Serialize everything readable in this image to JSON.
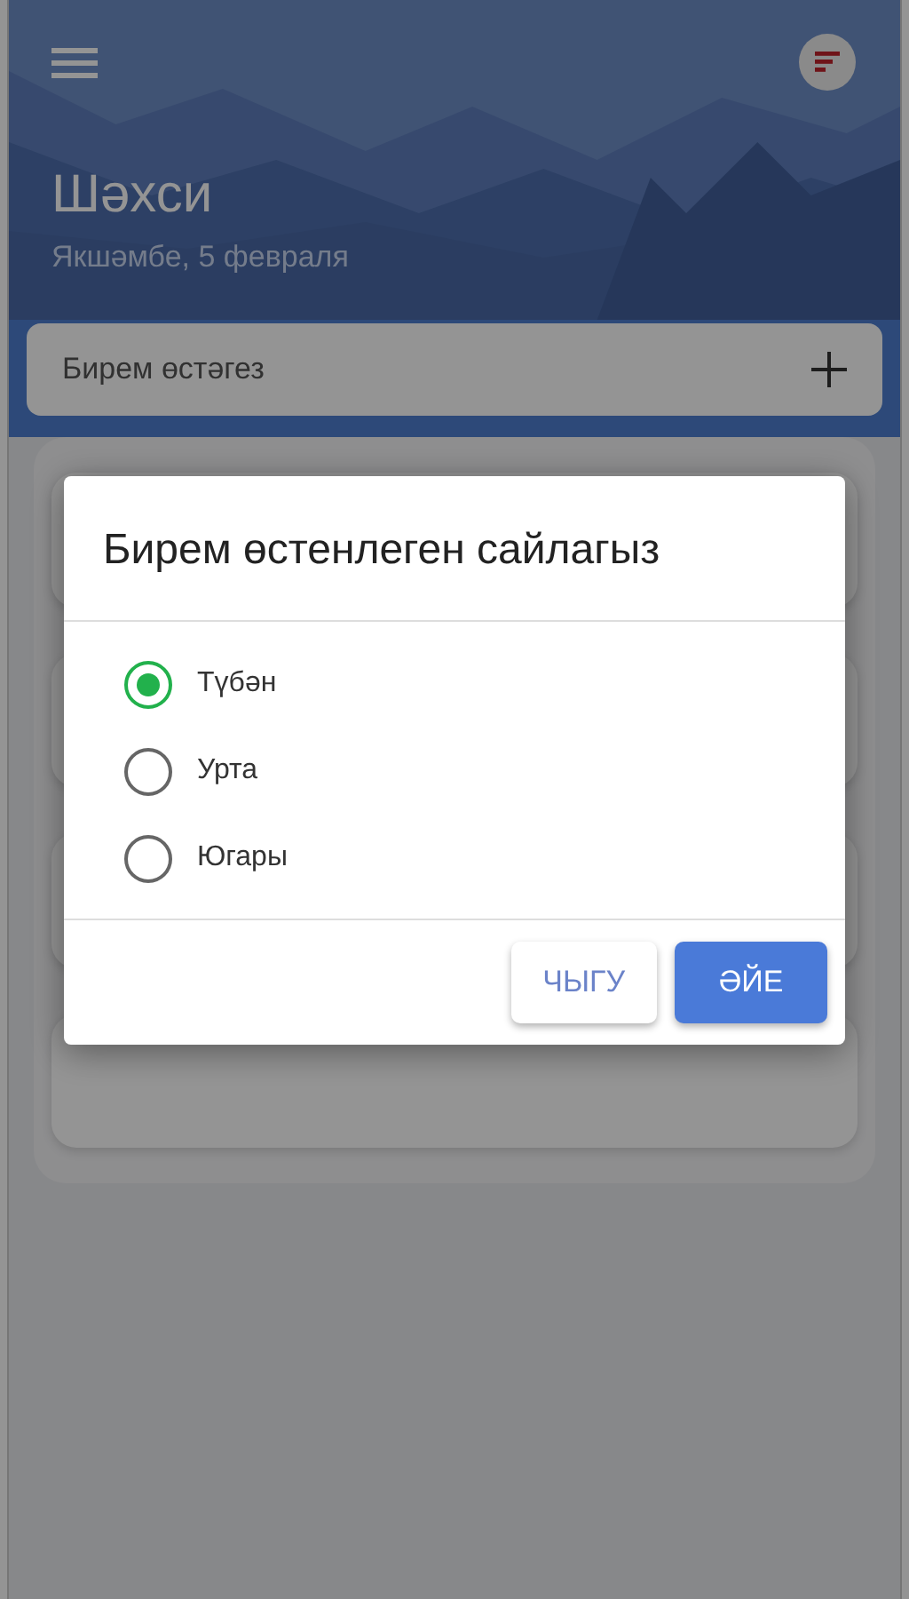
{
  "header": {
    "title": "Шәхси",
    "date": "Якшәмбе, 5 февраля"
  },
  "add_task": {
    "placeholder": "Бирем өстәгез"
  },
  "dialog": {
    "title": "Бирем өстенлеген сайлагыз",
    "options": [
      {
        "label": "Түбән",
        "selected": true
      },
      {
        "label": "Урта",
        "selected": false
      },
      {
        "label": "Югары",
        "selected": false
      }
    ],
    "buttons": [
      {
        "label": "ЧЫГУ",
        "kind": "secondary"
      },
      {
        "label": "ӘЙЕ",
        "kind": "primary"
      }
    ]
  }
}
